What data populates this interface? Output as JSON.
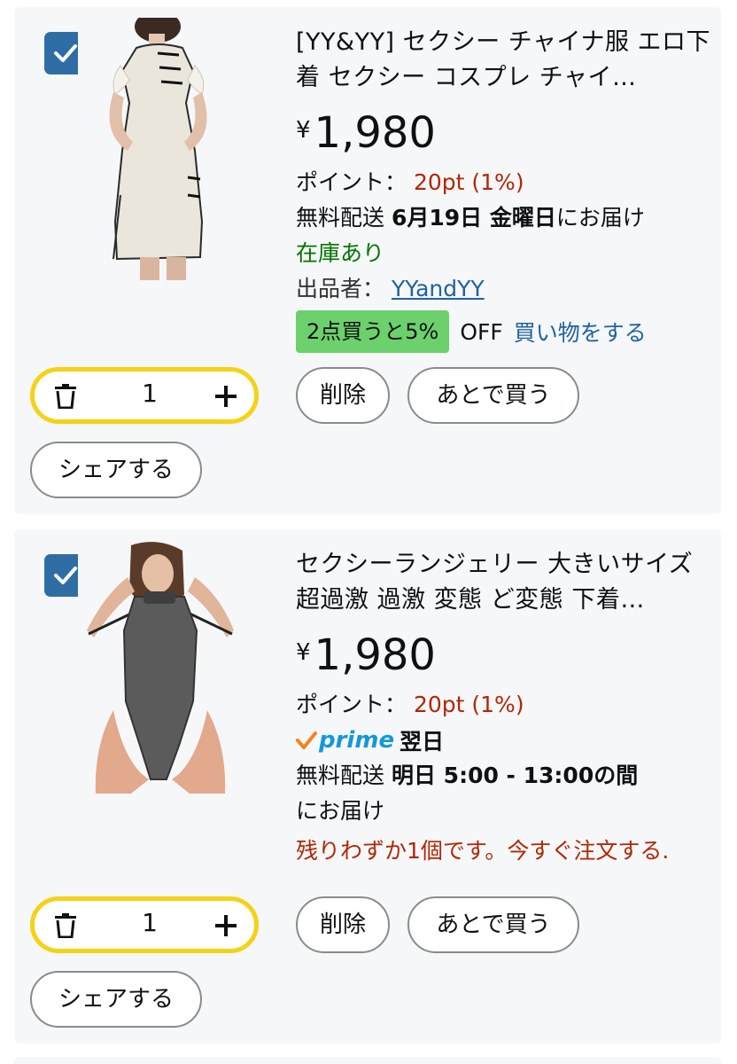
{
  "items": [
    {
      "title": "[YY&YY] セクシー チャイナ服 エロ下着 セクシー コスプレ チャイ…",
      "currency": "¥",
      "price": "1,980",
      "points_label": "ポイント：",
      "points_value": "20pt (1%)",
      "shipping_prefix": "無料配送",
      "shipping_date": "6月19日 金曜日",
      "shipping_suffix": "にお届け",
      "stock": "在庫あり",
      "seller_label": "出品者：",
      "seller_name": "YYandYY",
      "promo_badge": "2点買うと5%",
      "promo_off": "OFF",
      "promo_link": "買い物をする",
      "quantity": "1",
      "delete_label": "削除",
      "save_label": "あとで買う",
      "share_label": "シェアする",
      "checked": true
    },
    {
      "title": "セクシーランジェリー 大きいサイズ 超過激 過激 変態 ど変態 下着…",
      "currency": "¥",
      "price": "1,980",
      "points_label": "ポイント：",
      "points_value": "20pt (1%)",
      "prime_label": "prime",
      "prime_next": "翌日",
      "shipping_prefix": "無料配送",
      "shipping_date": "明日 5:00 - 13:00の間",
      "shipping_suffix": "にお届け",
      "low_stock": "残りわずか1個です。今すぐ注文する.",
      "quantity": "1",
      "delete_label": "削除",
      "save_label": "あとで買う",
      "share_label": "シェアする",
      "checked": true
    }
  ],
  "colors": {
    "checkbox": "#2e6ea5",
    "qty_border": "#f5d216",
    "promo_green": "#6cd16c",
    "price_red": "#b12704",
    "stock_green": "#007600",
    "link_blue": "#2162a1",
    "prime_blue": "#1399d8",
    "prime_check": "#f58220"
  }
}
